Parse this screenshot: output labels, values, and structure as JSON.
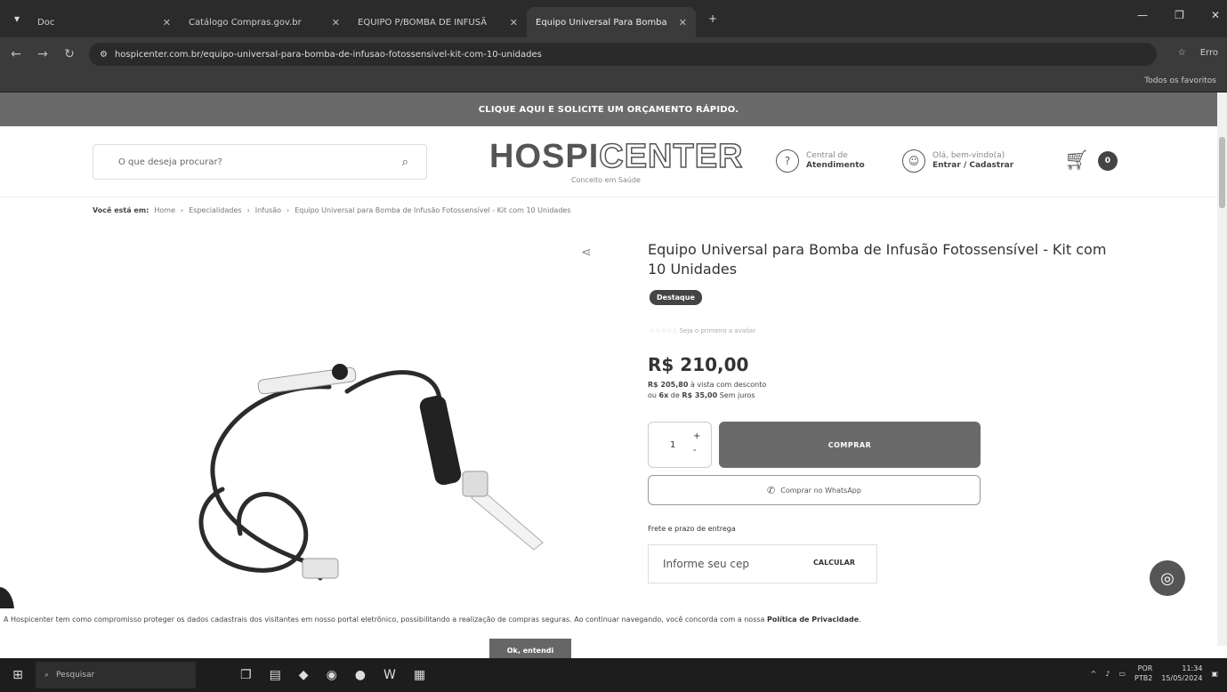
{
  "browser": {
    "tabs": [
      {
        "label": "Doc",
        "active": false
      },
      {
        "label": "Catálogo Compras.gov.br",
        "active": false
      },
      {
        "label": "EQUIPO P/BOMBA DE INFUSÃ",
        "active": false
      },
      {
        "label": "Equipo Universal Para Bomba",
        "active": true
      }
    ],
    "url": "hospicenter.com.br/equipo-universal-para-bomba-de-infusao-fotossensivel-kit-com-10-unidades",
    "profile_label": "Erro",
    "bookmarks_label": "Todos os favoritos"
  },
  "promo": {
    "text": "CLIQUE AQUI E SOLICITE UM ORÇAMENTO RÁPIDO."
  },
  "header": {
    "search_placeholder": "O que deseja procurar?",
    "logo_main_dark": "HOSPI",
    "logo_main_outline": "CENTER",
    "logo_tagline": "Conceito em Saúde",
    "support_line1": "Central de",
    "support_line2": "Atendimento",
    "account_line1": "Olá, bem-vindo(a)",
    "account_line2": "Entrar / Cadastrar",
    "cart_count": "0"
  },
  "breadcrumb": {
    "prefix": "Você está em:",
    "items": [
      "Home",
      "Especialidades",
      "Infusão",
      "Equipo Universal para Bomba de Infusão Fotossensível - Kit com 10 Unidades"
    ]
  },
  "product": {
    "title": "Equipo Universal para Bomba de Infusão Fotossensível - Kit com 10 Unidades",
    "badge": "Destaque",
    "reviews_text": "Seja o primeiro a avaliar",
    "price": "R$ 210,00",
    "pix_price": "R$ 205,80",
    "pix_suffix": "à vista com desconto",
    "inst_prefix": "ou",
    "inst_count": "6x",
    "inst_of": "de",
    "inst_value": "R$ 35,00",
    "inst_suffix": "Sem juros",
    "quantity": "1",
    "buy_label": "COMPRAR",
    "whatsapp_label": "Comprar no WhatsApp",
    "shipping_label": "Frete e prazo de entrega",
    "cep_placeholder": "Informe seu cep",
    "calc_label": "CALCULAR"
  },
  "cookie": {
    "text": "A Hospicenter tem como compromisso proteger os dados cadastrais dos visitantes em nosso portal eletrônico, possibilitando a realização de compras seguras. Ao continuar navegando, você concorda com a nossa",
    "link": "Política de Privacidade",
    "ok_label": "Ok, entendi"
  },
  "taskbar": {
    "search_label": "Pesquisar",
    "lang1": "POR",
    "lang2": "PTB2",
    "time": "11:34",
    "date": "15/05/2024"
  }
}
